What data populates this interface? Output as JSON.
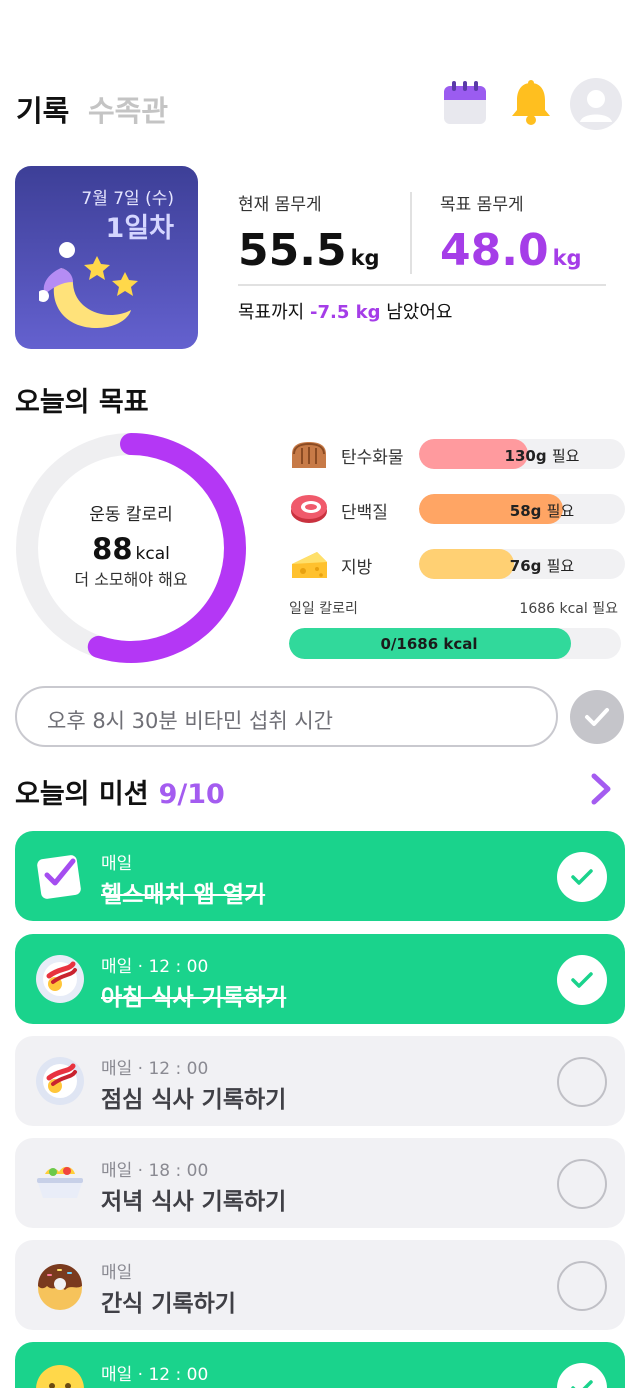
{
  "header": {
    "tab_active": "기록",
    "tab_inactive": "수족관",
    "icons": [
      "calendar-icon",
      "bell-icon",
      "avatar"
    ]
  },
  "day_card": {
    "date": "7월 7일 (수)",
    "day_count": "1일차"
  },
  "weight": {
    "current_label": "현재 몸무게",
    "current_value": "55.5",
    "current_unit": "kg",
    "goal_label": "목표 몸무게",
    "goal_value": "48.0",
    "goal_unit": "kg",
    "remain_prefix": "목표까지",
    "remain_value": "-7.5 kg",
    "remain_suffix": "남았어요"
  },
  "goal_section": {
    "title": "오늘의 목표",
    "exercise": {
      "label": "운동 칼로리",
      "value": "88",
      "unit": "kcal",
      "sub": "더 소모해야 해요",
      "progress_fraction": 0.55
    },
    "nutrients": [
      {
        "name": "탄수화물",
        "amount": "130g",
        "need": "필요",
        "fill_fraction": 0.53,
        "color": "#ff9a9e",
        "icon": "bread-icon"
      },
      {
        "name": "단백질",
        "amount": "58g",
        "need": "필요",
        "fill_fraction": 0.7,
        "color": "#ffa564",
        "icon": "meat-icon"
      },
      {
        "name": "지방",
        "amount": "76g",
        "need": "필요",
        "fill_fraction": 0.46,
        "color": "#ffd073",
        "icon": "cheese-icon"
      }
    ],
    "daily": {
      "label": "일일 칼로리",
      "need": "1686 kcal 필요",
      "value": "0/1686 kcal",
      "fill_fraction": 0.85
    }
  },
  "reminder": {
    "text": "오후 8시 30분 비타민 섭취 시간"
  },
  "missions": {
    "title": "오늘의 미션",
    "count": "9/10",
    "items": [
      {
        "meta": "매일",
        "title": "헬스매치 앱 열기",
        "done": true,
        "icon": "checklist-icon"
      },
      {
        "meta": "매일 · 12 : 00",
        "title": "아침 식사 기록하기",
        "done": true,
        "icon": "breakfast-plate-icon"
      },
      {
        "meta": "매일 · 12 : 00",
        "title": "점심 식사 기록하기",
        "done": false,
        "icon": "lunch-plate-icon"
      },
      {
        "meta": "매일 · 18 : 00",
        "title": "저녁 식사 기록하기",
        "done": false,
        "icon": "dinner-bowl-icon"
      },
      {
        "meta": "매일",
        "title": "간식 기록하기",
        "done": false,
        "icon": "donut-icon"
      },
      {
        "meta": "매일 · 12 : 00",
        "title": "",
        "done": true,
        "icon": "smiley-icon"
      }
    ]
  },
  "colors": {
    "accent_purple": "#a53de8",
    "mission_done": "#1ad38c",
    "card_gradient_top": "#3d3f97",
    "card_gradient_bottom": "#6461cf"
  }
}
